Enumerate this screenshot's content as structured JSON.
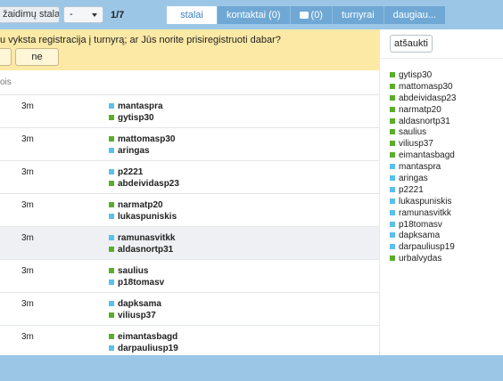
{
  "topbar": {
    "game_tables_label": "žaidimų stalas",
    "select_value": "-",
    "pager": "1/7",
    "tabs": [
      {
        "label": "stalai"
      },
      {
        "label": "kontaktai (0)"
      },
      {
        "label": "(0)"
      },
      {
        "label": "turnyrai"
      },
      {
        "label": "daugiau..."
      }
    ]
  },
  "banner": {
    "text": "u vyksta registracija į turnyrą; ar Jūs norite prisiregistruoti dabar?",
    "yes_label": "",
    "no_label": "ne"
  },
  "table": {
    "header": "ois",
    "rows": [
      {
        "time": "3m",
        "p1": "mantaspra",
        "c1": "b",
        "p2": "gytisp30",
        "c2": "g"
      },
      {
        "time": "3m",
        "p1": "mattomasp30",
        "c1": "g",
        "p2": "aringas",
        "c2": "b"
      },
      {
        "time": "3m",
        "p1": "p2221",
        "c1": "b",
        "p2": "abdeividasp23",
        "c2": "g"
      },
      {
        "time": "3m",
        "p1": "narmatp20",
        "c1": "g",
        "p2": "lukaspuniskis",
        "c2": "b"
      },
      {
        "time": "3m",
        "p1": "ramunasvitkk",
        "c1": "b",
        "p2": "aldasnortp31",
        "c2": "g"
      },
      {
        "time": "3m",
        "p1": "saulius",
        "c1": "g",
        "p2": "p18tomasv",
        "c2": "b"
      },
      {
        "time": "3m",
        "p1": "dapksama",
        "c1": "b",
        "p2": "viliusp37",
        "c2": "g"
      },
      {
        "time": "3m",
        "p1": "eimantasbagd",
        "c1": "g",
        "p2": "darpauliusp19",
        "c2": "b"
      }
    ]
  },
  "panel": {
    "cancel_label": "atšaukti",
    "users": [
      {
        "name": "gytisp30",
        "c": "g"
      },
      {
        "name": "mattomasp30",
        "c": "g"
      },
      {
        "name": "abdeividasp23",
        "c": "g"
      },
      {
        "name": "narmatp20",
        "c": "g"
      },
      {
        "name": "aldasnortp31",
        "c": "g"
      },
      {
        "name": "saulius",
        "c": "g"
      },
      {
        "name": "viliusp37",
        "c": "g"
      },
      {
        "name": "eimantasbagd",
        "c": "g"
      },
      {
        "name": "mantaspra",
        "c": "b"
      },
      {
        "name": "aringas",
        "c": "b"
      },
      {
        "name": "p2221",
        "c": "b"
      },
      {
        "name": "lukaspuniskis",
        "c": "b"
      },
      {
        "name": "ramunasvitkk",
        "c": "b"
      },
      {
        "name": "p18tomasv",
        "c": "b"
      },
      {
        "name": "dapksama",
        "c": "b"
      },
      {
        "name": "darpauliusp19",
        "c": "b"
      },
      {
        "name": "urbalvydas",
        "c": "g"
      }
    ]
  },
  "colors": {
    "blue_marker": "#5bc0eb",
    "green_marker": "#5aad2b",
    "topbar": "#9cc6e6",
    "banner": "#fde9a6"
  }
}
